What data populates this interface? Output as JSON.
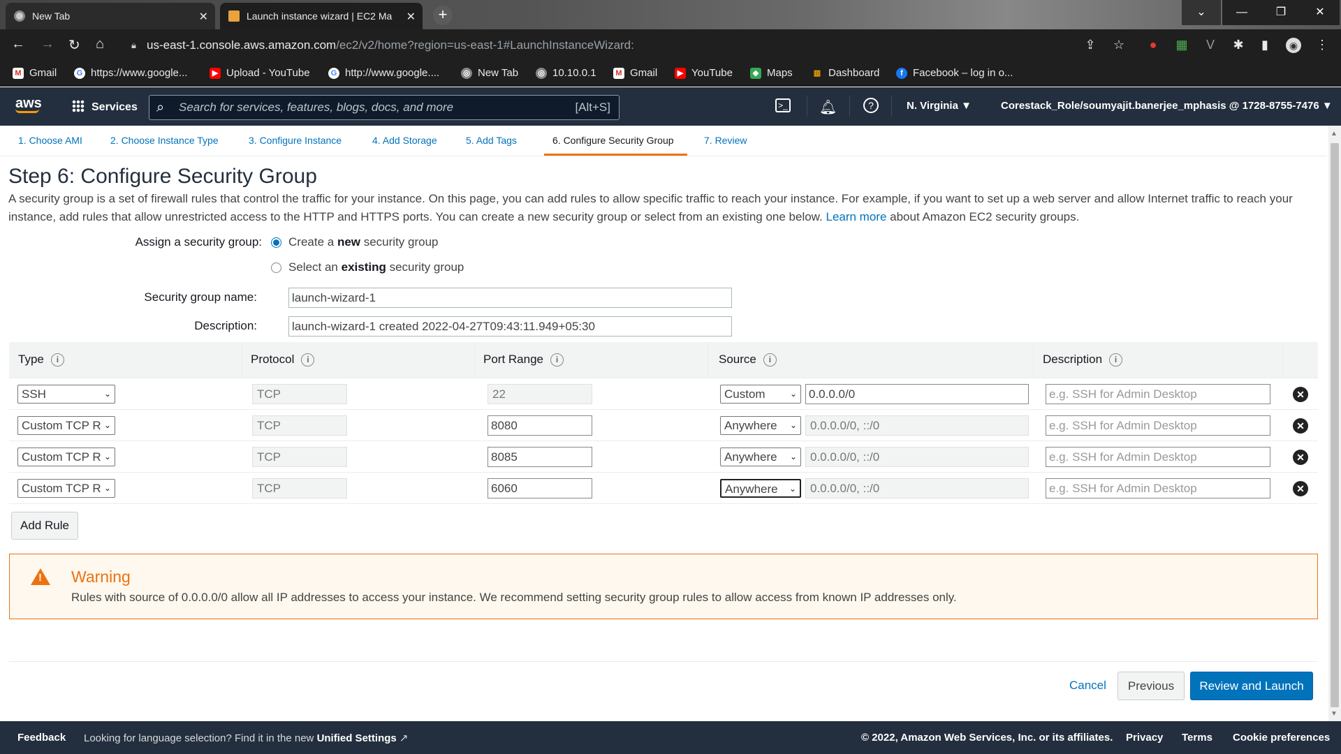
{
  "browser": {
    "tabs": [
      {
        "title": "New Tab"
      },
      {
        "title": "Launch instance wizard | EC2 Ma"
      }
    ],
    "url_host": "us-east-1.console.aws.amazon.com",
    "url_path": "/ec2/v2/home?region=us-east-1#LaunchInstanceWizard:",
    "bookmarks": [
      {
        "label": "Gmail",
        "icon": "gmail-icon"
      },
      {
        "label": "https://www.google...",
        "icon": "google-icon"
      },
      {
        "label": "Upload - YouTube",
        "icon": "youtube-icon"
      },
      {
        "label": "http://www.google....",
        "icon": "google-icon"
      },
      {
        "label": "New Tab",
        "icon": "globe-icon"
      },
      {
        "label": "10.10.0.1",
        "icon": "globe-icon"
      },
      {
        "label": "Gmail",
        "icon": "gmail-icon"
      },
      {
        "label": "YouTube",
        "icon": "youtube-icon"
      },
      {
        "label": "Maps",
        "icon": "maps-icon"
      },
      {
        "label": "Dashboard",
        "icon": "dashboard-icon"
      },
      {
        "label": "Facebook – log in o...",
        "icon": "facebook-icon"
      }
    ]
  },
  "aws_nav": {
    "logo": "aws",
    "services": "Services",
    "search_placeholder": "Search for services, features, blogs, docs, and more",
    "search_shortcut": "[Alt+S]",
    "region": "N. Virginia",
    "account": "Corestack_Role/soumyajit.banerjee_mphasis @ 1728-8755-7476"
  },
  "steps": [
    "1. Choose AMI",
    "2. Choose Instance Type",
    "3. Configure Instance",
    "4. Add Storage",
    "5. Add Tags",
    "6. Configure Security Group",
    "7. Review"
  ],
  "page": {
    "title": "Step 6: Configure Security Group",
    "intro": "A security group is a set of firewall rules that control the traffic for your instance. On this page, you can add rules to allow specific traffic to reach your instance. For example, if you want to set up a web server and allow Internet traffic to reach your instance, add rules that allow unrestricted access to the HTTP and HTTPS ports. You can create a new security group or select from an existing one below.",
    "learn_more": "Learn more",
    "intro_tail": " about Amazon EC2 security groups.",
    "assign_label": "Assign a security group:",
    "radio_new_pre": "Create a ",
    "radio_new_bold": "new",
    "radio_new_post": " security group",
    "radio_existing_pre": "Select an ",
    "radio_existing_bold": "existing",
    "radio_existing_post": " security group",
    "sg_name_label": "Security group name:",
    "sg_name_value": "launch-wizard-1",
    "desc_label": "Description:",
    "desc_value": "launch-wizard-1 created 2022-04-27T09:43:11.949+05:30"
  },
  "table": {
    "headers": [
      "Type",
      "Protocol",
      "Port Range",
      "Source",
      "Description"
    ],
    "desc_placeholder": "e.g. SSH for Admin Desktop",
    "rows": [
      {
        "type": "SSH",
        "protocol": "TCP",
        "port": "22",
        "source": "Custom",
        "cidr": "0.0.0.0/0"
      },
      {
        "type": "Custom TCP R",
        "protocol": "TCP",
        "port": "8080",
        "source": "Anywhere",
        "cidr": "0.0.0.0/0, ::/0"
      },
      {
        "type": "Custom TCP R",
        "protocol": "TCP",
        "port": "8085",
        "source": "Anywhere",
        "cidr": "0.0.0.0/0, ::/0"
      },
      {
        "type": "Custom TCP R",
        "protocol": "TCP",
        "port": "6060",
        "source": "Anywhere",
        "cidr": "0.0.0.0/0, ::/0"
      }
    ],
    "add_rule": "Add Rule"
  },
  "warning": {
    "title": "Warning",
    "text": "Rules with source of 0.0.0.0/0 allow all IP addresses to access your instance. We recommend setting security group rules to allow access from known IP addresses only."
  },
  "actions": {
    "cancel": "Cancel",
    "previous": "Previous",
    "review": "Review and Launch"
  },
  "footer": {
    "feedback": "Feedback",
    "lang_text": "Looking for language selection? Find it in the new",
    "unified": "Unified Settings",
    "copyright": "© 2022, Amazon Web Services, Inc. or its affiliates.",
    "privacy": "Privacy",
    "terms": "Terms",
    "cookie": "Cookie preferences"
  },
  "colors": {
    "aws_nav": "#232f3e",
    "link": "#0073bb",
    "accent_orange": "#ec7211",
    "primary_button": "#0073bb"
  }
}
